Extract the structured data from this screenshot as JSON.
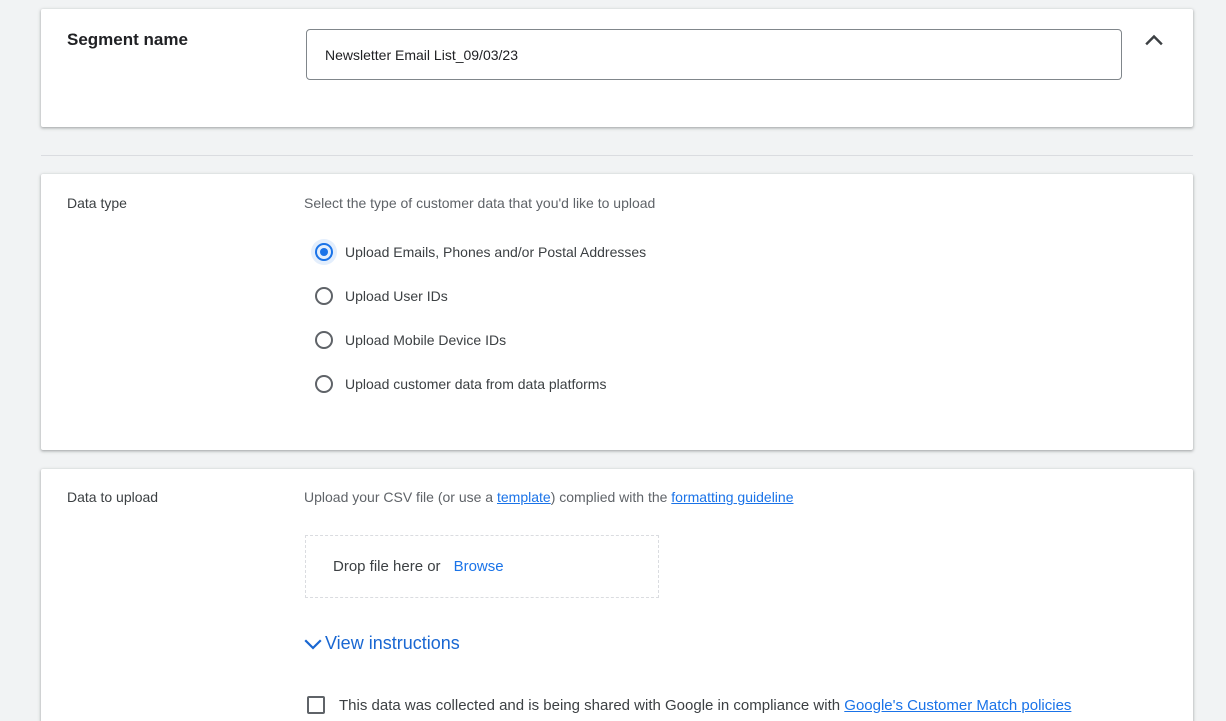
{
  "segment": {
    "label": "Segment name",
    "value": "Newsletter Email List_09/03/23",
    "collapse_icon": "chevron-up-icon"
  },
  "data_type": {
    "label": "Data type",
    "prompt": "Select the type of customer data that you'd like to upload",
    "options": [
      {
        "label": "Upload Emails, Phones and/or Postal Addresses",
        "selected": true
      },
      {
        "label": "Upload User IDs",
        "selected": false
      },
      {
        "label": "Upload Mobile Device IDs",
        "selected": false
      },
      {
        "label": "Upload customer data from data platforms",
        "selected": false
      }
    ]
  },
  "upload": {
    "label": "Data to upload",
    "prompt_before": "Upload your CSV file (or use a ",
    "template_link": "template",
    "prompt_middle": ") complied with the ",
    "guideline_link": "formatting guideline",
    "dropzone_text": "Drop file here or",
    "browse_label": "Browse",
    "instructions_label": "View instructions",
    "consent_text": "This data was collected and is being shared with Google in compliance with ",
    "consent_link": "Google's Customer Match policies"
  },
  "colors": {
    "accent": "#1a73e8",
    "link": "#1967d2",
    "background": "#f1f3f4"
  }
}
